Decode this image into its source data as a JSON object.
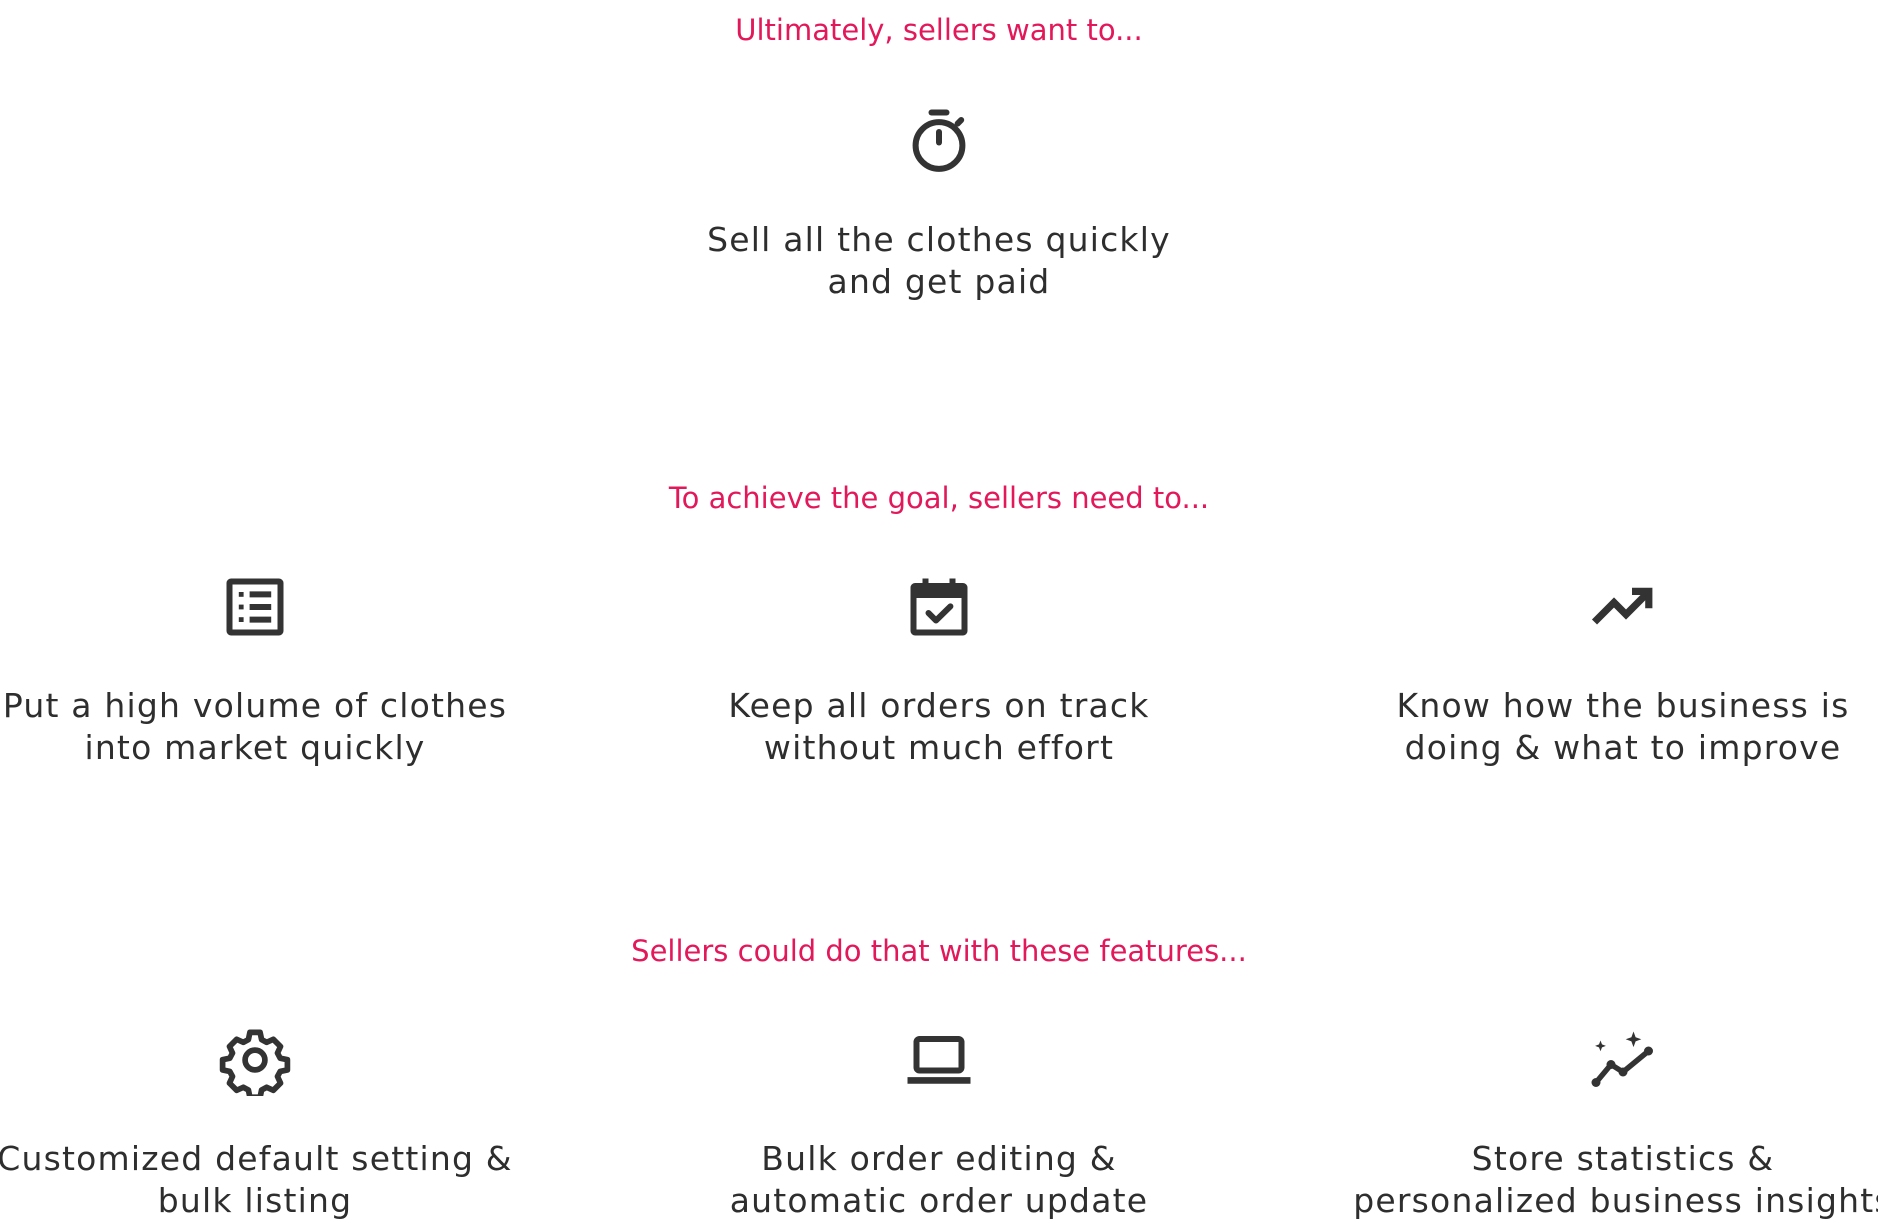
{
  "section_goal": {
    "heading": "Ultimately, sellers want to...",
    "items": [
      {
        "icon": "stopwatch-icon",
        "line1": "Sell all the clothes quickly",
        "line2": "and get paid"
      }
    ]
  },
  "section_needs": {
    "heading": "To achieve the goal, sellers need to...",
    "items": [
      {
        "icon": "list-icon",
        "line1": "Put a high volume of clothes",
        "line2": "into market quickly"
      },
      {
        "icon": "calendar-check-icon",
        "line1": "Keep all orders on track",
        "line2": "without much effort"
      },
      {
        "icon": "trending-up-icon",
        "line1": "Know how the business is",
        "line2": "doing & what to improve"
      }
    ]
  },
  "section_features": {
    "heading": "Sellers could do that with these features...",
    "items": [
      {
        "icon": "gear-icon",
        "line1": "Customized default setting &",
        "line2": "bulk listing"
      },
      {
        "icon": "laptop-icon",
        "line1": "Bulk order editing &",
        "line2": "automatic order update"
      },
      {
        "icon": "insights-chart-icon",
        "line1": "Store statistics &",
        "line2": "personalized business insights"
      }
    ]
  },
  "colors": {
    "heading": "#e2185b",
    "text": "#2e2e2e",
    "icon": "#333333"
  }
}
